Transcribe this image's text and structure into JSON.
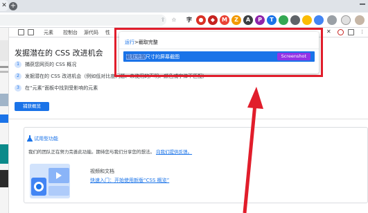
{
  "browser": {
    "tab_close_glyph": "✕",
    "new_tab_glyph": "+",
    "extensions": [
      {
        "name": "share-icon",
        "glyph": "⇪",
        "color": "#9aa0a6"
      },
      {
        "name": "star-icon",
        "glyph": "☆",
        "color": "#5f6368"
      },
      {
        "name": "translate-icon",
        "glyph": "字",
        "color": "#202124"
      },
      {
        "name": "extension-red-icon",
        "glyph": "●",
        "color": "#d93025"
      },
      {
        "name": "extension-shield-icon",
        "glyph": "◆",
        "color": "#c5221f"
      },
      {
        "name": "extension-mail-icon",
        "glyph": "M",
        "color": "#ea4335"
      },
      {
        "name": "extension-orange-icon",
        "glyph": "Z",
        "color": "#f29900"
      },
      {
        "name": "extension-dark-icon",
        "glyph": "A",
        "color": "#3c4043"
      },
      {
        "name": "extension-purple-icon",
        "glyph": "P",
        "color": "#8e24aa"
      },
      {
        "name": "extension-blue-icon",
        "glyph": "T",
        "color": "#1a73e8"
      }
    ]
  },
  "devtools": {
    "tabs": [
      "元素",
      "控制台",
      "源代码",
      "性"
    ],
    "close_glyph": "✕",
    "more_glyph": "⋮"
  },
  "css_overview": {
    "title": "发掘潜在的 CSS 改进机会",
    "steps": [
      {
        "num": "1",
        "text": "捕获您网页的 CSS 概况"
      },
      {
        "num": "2",
        "text": "发掘潜在的 CSS 改进机会（例如低对比度问题、未使用的声明、颜色或字体不匹配）"
      },
      {
        "num": "3",
        "text": "在“元素”面板中找到受影响的元素"
      }
    ],
    "capture_button": "捕获概览"
  },
  "experiment": {
    "title": "试用型功能",
    "desc": "我们的团队正在努力完善此功能。期待您与我们分享您的想法。",
    "feedback_link": "向我们提供反馈。",
    "video_label": "视频和文档",
    "video_link": "快速入门：开始使用新版“CSS 概览”"
  },
  "command_menu": {
    "prefix": "运行",
    "query": ">截取完整",
    "item_highlight": "截取完整",
    "item_rest": "尺寸的屏幕截图",
    "badge": "Screenshot"
  },
  "colors": {
    "accent": "#1a73e8",
    "annotation_red": "#e11d2b",
    "badge_purple": "#9334e6"
  }
}
